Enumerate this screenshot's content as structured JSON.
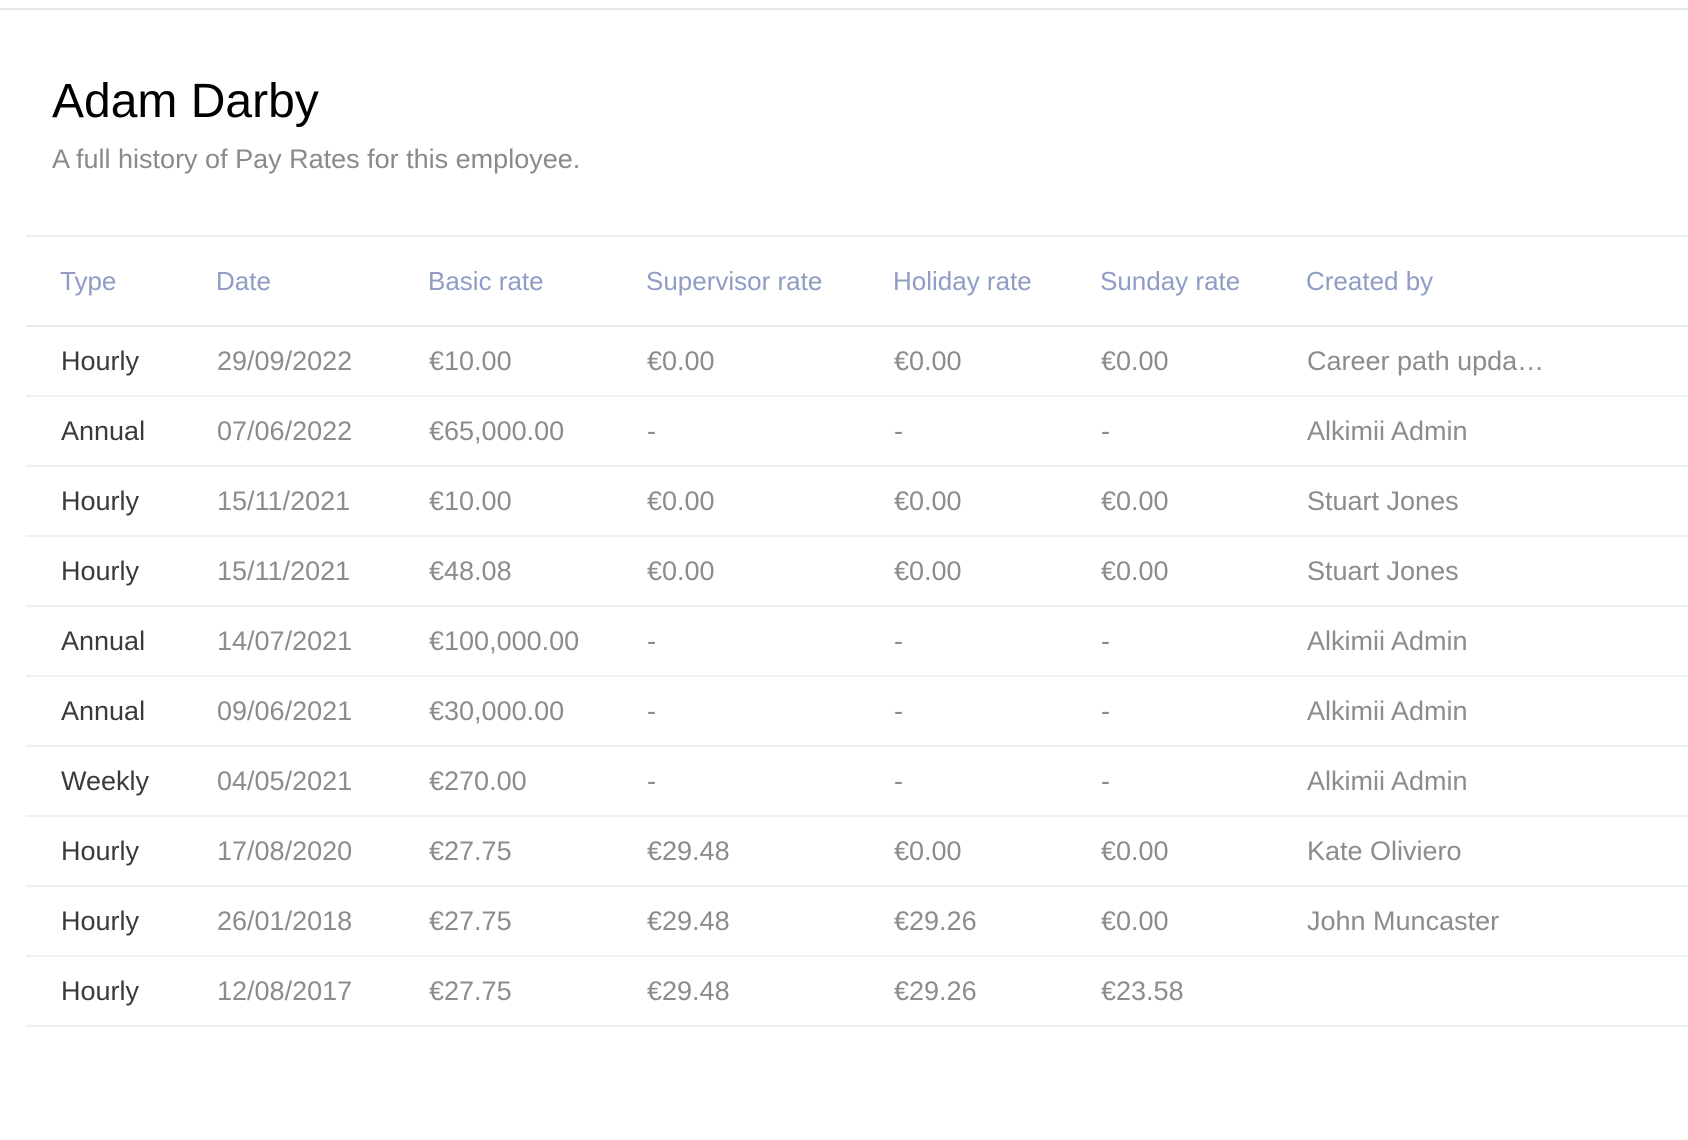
{
  "employee": {
    "name": "Adam Darby",
    "subtitle": "A full history of Pay Rates for this employee."
  },
  "table": {
    "columns": [
      "Type",
      "Date",
      "Basic rate",
      "Supervisor rate",
      "Holiday rate",
      "Sunday rate",
      "Created by"
    ],
    "rows": [
      [
        "Hourly",
        "29/09/2022",
        "€10.00",
        "€0.00",
        "€0.00",
        "€0.00",
        "Career path upda…"
      ],
      [
        "Annual",
        "07/06/2022",
        "€65,000.00",
        "-",
        "-",
        "-",
        "Alkimii Admin"
      ],
      [
        "Hourly",
        "15/11/2021",
        "€10.00",
        "€0.00",
        "€0.00",
        "€0.00",
        "Stuart Jones"
      ],
      [
        "Hourly",
        "15/11/2021",
        "€48.08",
        "€0.00",
        "€0.00",
        "€0.00",
        "Stuart Jones"
      ],
      [
        "Annual",
        "14/07/2021",
        "€100,000.00",
        "-",
        "-",
        "-",
        "Alkimii Admin"
      ],
      [
        "Annual",
        "09/06/2021",
        "€30,000.00",
        "-",
        "-",
        "-",
        "Alkimii Admin"
      ],
      [
        "Weekly",
        "04/05/2021",
        "€270.00",
        "-",
        "-",
        "-",
        "Alkimii Admin"
      ],
      [
        "Hourly",
        "17/08/2020",
        "€27.75",
        "€29.48",
        "€0.00",
        "€0.00",
        "Kate Oliviero"
      ],
      [
        "Hourly",
        "26/01/2018",
        "€27.75",
        "€29.48",
        "€29.26",
        "€0.00",
        "John Muncaster"
      ],
      [
        "Hourly",
        "12/08/2017",
        "€27.75",
        "€29.48",
        "€29.26",
        "€23.58",
        ""
      ]
    ]
  },
  "colors": {
    "header_text": "#8f9cc4",
    "type_text": "#3a3a3a",
    "cell_text": "#8c8c8c",
    "title_text": "#000000",
    "subtitle_text": "#8a8a8a"
  }
}
